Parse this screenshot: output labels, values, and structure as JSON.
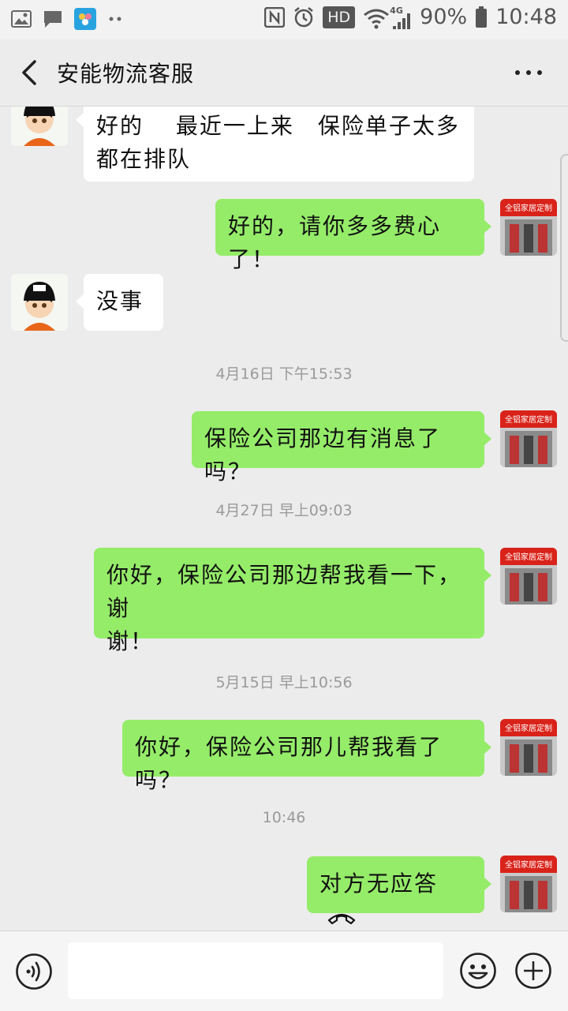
{
  "status_bar": {
    "battery": "90%",
    "time": "10:48",
    "hd_label": "HD",
    "network": "4G",
    "icons": [
      "image-icon",
      "message-icon",
      "app-icon",
      "dots-icon",
      "nfc-icon",
      "alarm-icon",
      "wifi-icon",
      "signal-icon",
      "battery-icon"
    ]
  },
  "header": {
    "title": "安能物流客服",
    "icons": [
      "back-arrow-icon",
      "more-dots-icon"
    ]
  },
  "messages": [
    {
      "side": "left",
      "text": "好的　 最近一上来　保险单子太多\n都在排队"
    },
    {
      "side": "right",
      "text": "好的，请你多多费心了！"
    },
    {
      "side": "left",
      "text": "没事"
    },
    {
      "type": "timestamp",
      "text": "4月16日 下午15:53"
    },
    {
      "side": "right",
      "text": "保险公司那边有消息了吗？"
    },
    {
      "type": "timestamp",
      "text": "4月27日 早上09:03"
    },
    {
      "side": "right",
      "text": "你好，保险公司那边帮我看一下，谢\n谢！"
    },
    {
      "type": "timestamp",
      "text": "5月15日 早上10:56"
    },
    {
      "side": "right",
      "text": "你好，保险公司那儿帮我看了吗？"
    },
    {
      "type": "timestamp",
      "text": "10:46"
    },
    {
      "side": "right",
      "text": "对方无应答",
      "icon": "hangup-phone-icon"
    }
  ],
  "store_avatar_sign": "全铝家居定制",
  "input_bar": {
    "icons": [
      "voice-icon",
      "emoji-icon",
      "plus-icon"
    ]
  },
  "colors": {
    "bubble_self": "#95ec69",
    "bubble_other": "#ffffff",
    "background": "#ececec",
    "avatar_cap": "#111111",
    "avatar_shirt": "#e8651a",
    "store_sign": "#d9231a"
  }
}
